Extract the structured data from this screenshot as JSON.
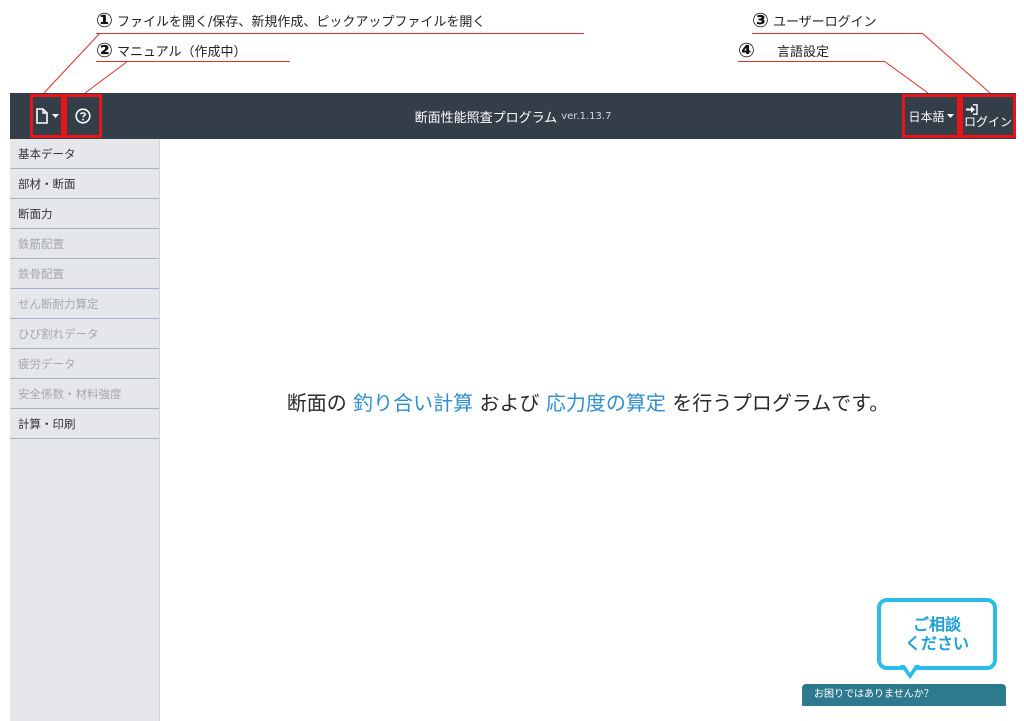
{
  "annotations": [
    {
      "num": "①",
      "text": "ファイルを開く/保存、新規作成、ピックアップファイルを開く"
    },
    {
      "num": "②",
      "text": "マニュアル（作成中）"
    },
    {
      "num": "③",
      "text": "ユーザーログイン"
    },
    {
      "num": "④",
      "text": "言語設定"
    }
  ],
  "header": {
    "title": "断面性能照査プログラム",
    "version": "ver.1.13.7",
    "file_icon": "file-icon",
    "help_icon": "help-circle-icon",
    "language": "日本語",
    "login_icon": "sign-in-icon",
    "login_label": "ログイン"
  },
  "sidebar": {
    "items": [
      {
        "label": "基本データ",
        "enabled": true
      },
      {
        "label": "部材・断面",
        "enabled": true
      },
      {
        "label": "断面力",
        "enabled": true
      },
      {
        "label": "鉄筋配置",
        "enabled": false
      },
      {
        "label": "鉄骨配置",
        "enabled": false
      },
      {
        "label": "せん断耐力算定",
        "enabled": false
      },
      {
        "label": "ひび割れデータ",
        "enabled": false
      },
      {
        "label": "疲労データ",
        "enabled": false
      },
      {
        "label": "安全係数・材料強度",
        "enabled": false
      },
      {
        "label": "計算・印刷",
        "enabled": true
      }
    ]
  },
  "main": {
    "hero": {
      "part1": "断面の",
      "highlight1": "釣り合い計算",
      "part2": "および",
      "highlight2": "応力度の算定",
      "part3": "を行うプログラムです。"
    }
  },
  "chat": {
    "bubble_line1": "ご相談",
    "bubble_line2": "ください",
    "bar_label": "お困りではありませんか？"
  },
  "colors": {
    "header_bg": "#343e48",
    "highlight_box": "#e8141c",
    "accent_text": "#2e8fd0",
    "chat_bubble": "#2bbce8",
    "chat_bar": "#2d7a8f"
  }
}
